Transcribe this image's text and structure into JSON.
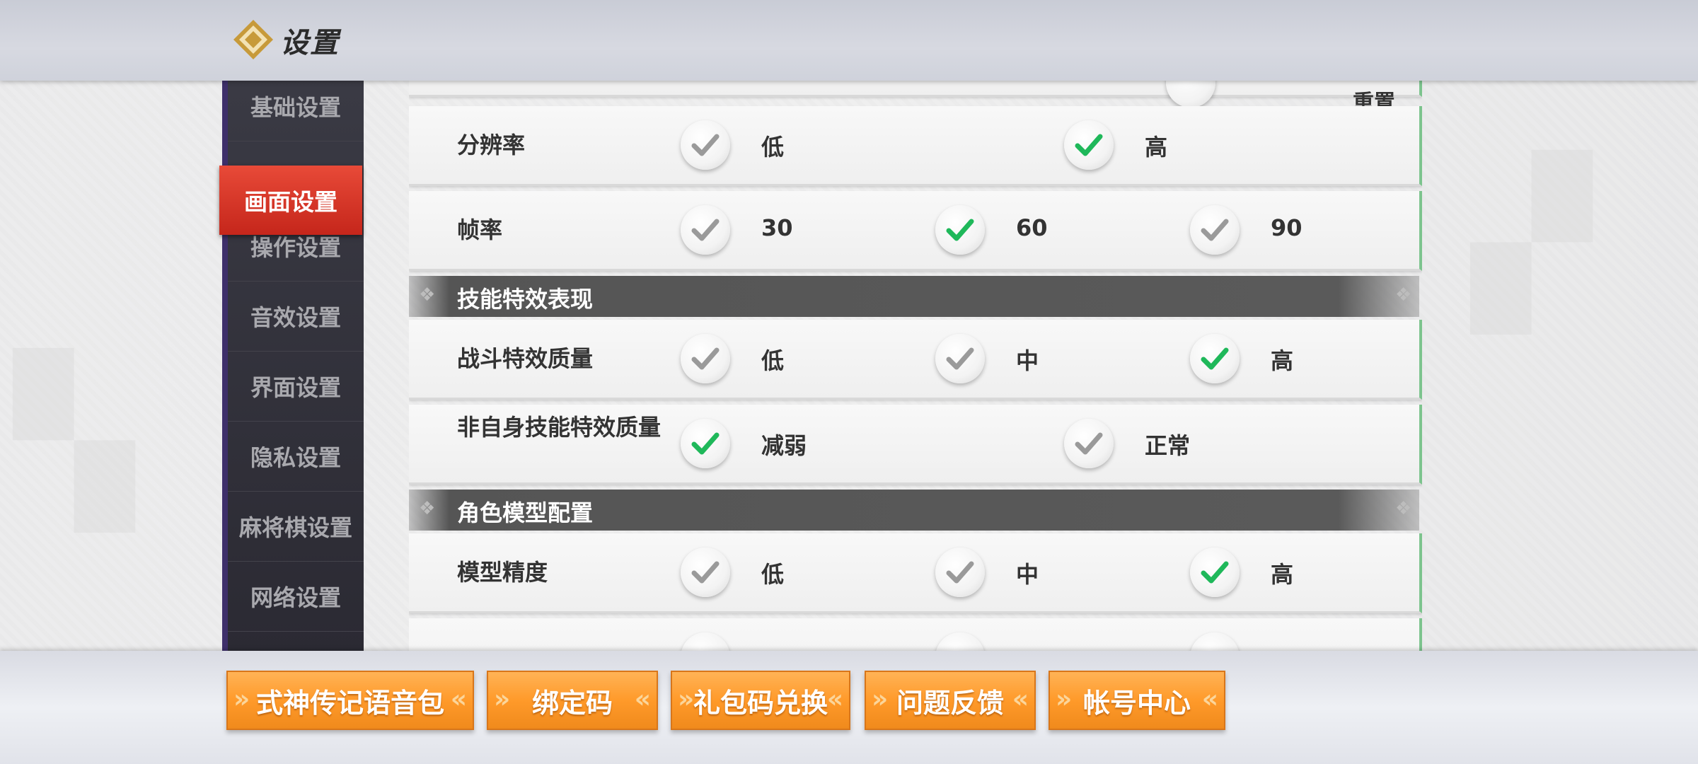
{
  "header": {
    "title": "设置",
    "logo_icon": "diamond-logo-icon"
  },
  "sidebar": {
    "items": [
      {
        "label": "基础设置"
      },
      {
        "label": "画面设置",
        "active": true
      },
      {
        "label": "操作设置"
      },
      {
        "label": "音效设置"
      },
      {
        "label": "界面设置"
      },
      {
        "label": "隐私设置"
      },
      {
        "label": "麻将棋设置"
      },
      {
        "label": "网络设置"
      }
    ]
  },
  "settings": {
    "reset_label": "重置",
    "resolution": {
      "label": "分辨率",
      "options": [
        "低",
        "高"
      ],
      "selected": "高"
    },
    "framerate": {
      "label": "帧率",
      "options": [
        "30",
        "60",
        "90"
      ],
      "selected": "60"
    },
    "section_skill": {
      "title": "技能特效表现"
    },
    "battle_effects": {
      "label": "战斗特效质量",
      "options": [
        "低",
        "中",
        "高"
      ],
      "selected": "高"
    },
    "other_skill_effects": {
      "label": "非自身技能特效质量",
      "options": [
        "减弱",
        "正常"
      ],
      "selected": "减弱"
    },
    "section_model": {
      "title": "角色模型配置"
    },
    "model_precision": {
      "label": "模型精度",
      "options": [
        "低",
        "中",
        "高"
      ],
      "selected": "高"
    }
  },
  "bottom_buttons": [
    {
      "label": "式神传记语音包"
    },
    {
      "label": "绑定码"
    },
    {
      "label": "礼包码兑换"
    },
    {
      "label": "问题反馈"
    },
    {
      "label": "帐号中心"
    }
  ],
  "colors": {
    "check_selected": "#1fb85a",
    "check_unselected": "#9a9a9a",
    "active_tab": "#d9332a",
    "orange_button": "#ff9a2a"
  }
}
